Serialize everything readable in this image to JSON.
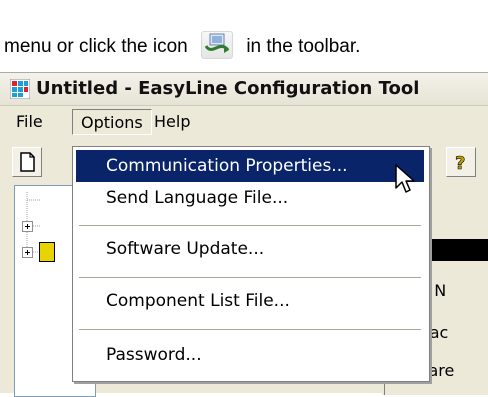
{
  "caption": {
    "before_icon": "menu or click the icon",
    "after_icon": "in the toolbar.",
    "icon": "communication-properties-icon"
  },
  "window": {
    "title": "Untitled - EasyLine Configuration Tool",
    "app_icon": "app-icon"
  },
  "menubar": {
    "file": "File",
    "options": "Options",
    "help": "Help"
  },
  "toolbar": {
    "new_icon": "new-document-icon",
    "help_icon": "help-question-icon"
  },
  "dropdown": {
    "items": [
      {
        "label": "Communication Properties...",
        "selected": true
      },
      {
        "label": "Send Language File...",
        "selected": false
      },
      {
        "label": "Software Update...",
        "selected": false
      },
      {
        "label": "Component List File...",
        "selected": false
      },
      {
        "label": "Password...",
        "selected": false
      }
    ]
  },
  "panel": {
    "labels": [
      "erial N",
      "anufac",
      "oftware"
    ]
  },
  "colors": {
    "menu_highlight": "#0a246a",
    "window_bg": "#ece9d8",
    "tree_yellow": "#e8d400"
  }
}
